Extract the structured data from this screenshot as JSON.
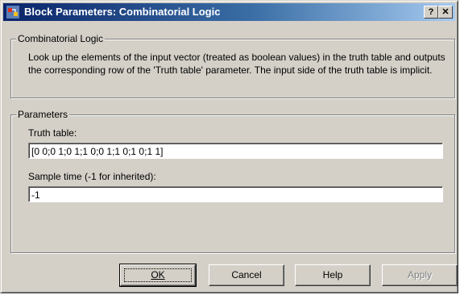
{
  "window": {
    "title": "Block Parameters: Combinatorial Logic"
  },
  "titlebar_buttons": {
    "help": "?",
    "close": "✕"
  },
  "description_group": {
    "legend": "Combinatorial Logic",
    "text": "Look up the elements of the input vector (treated as boolean values) in the truth table and outputs the corresponding row of the 'Truth table' parameter.  The input side of the truth table is implicit."
  },
  "parameters_group": {
    "legend": "Parameters",
    "truth_table": {
      "label": "Truth table:",
      "value": "[0 0;0 1;0 1;1 0;0 1;1 0;1 0;1 1]"
    },
    "sample_time": {
      "label": "Sample time (-1 for inherited):",
      "value": "-1"
    }
  },
  "buttons": {
    "ok": "OK",
    "cancel": "Cancel",
    "help": "Help",
    "apply": "Apply"
  },
  "icons": {
    "app": "simulink-block-icon",
    "help": "question-icon",
    "close": "close-icon"
  },
  "colors": {
    "titlebar_start": "#0a246a",
    "titlebar_end": "#a6caf0",
    "face": "#d4d0c8"
  }
}
